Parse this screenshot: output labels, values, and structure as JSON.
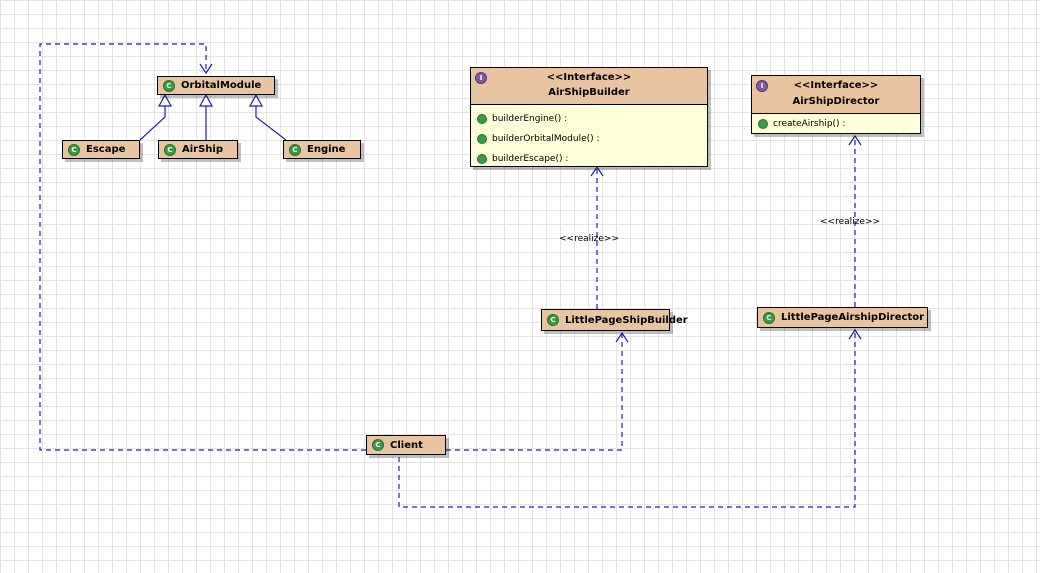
{
  "classes": {
    "orbital_module": "OrbitalModule",
    "escape": "Escape",
    "airship": "AirShip",
    "engine": "Engine",
    "little_page_ship_builder": "LittlePageShipBuilder",
    "little_page_airship_director": "LittlePageAirshipDirector",
    "client": "Client"
  },
  "interfaces": {
    "airship_builder": {
      "stereotype": "<<Interface>>",
      "name": "AirShipBuilder",
      "operations": [
        "builderEngine() :",
        "builderOrbitalModule() :",
        "builderEscape() :"
      ]
    },
    "airship_director": {
      "stereotype": "<<Interface>>",
      "name": "AirShipDirector",
      "operations": [
        "createAirship() :"
      ]
    }
  },
  "relations": {
    "realize_label_builder": "<<realize>>",
    "realize_label_director": "<<realize>>"
  },
  "icons": {
    "class": "class-icon",
    "interface": "interface-icon",
    "operation": "public-operation-icon"
  },
  "colors": {
    "class_fill": "#e8c4a0",
    "interface_body": "#ffffd9",
    "line": "#1f1fb4",
    "class_icon": "#3a9a48",
    "interface_icon": "#7b5aa6"
  }
}
